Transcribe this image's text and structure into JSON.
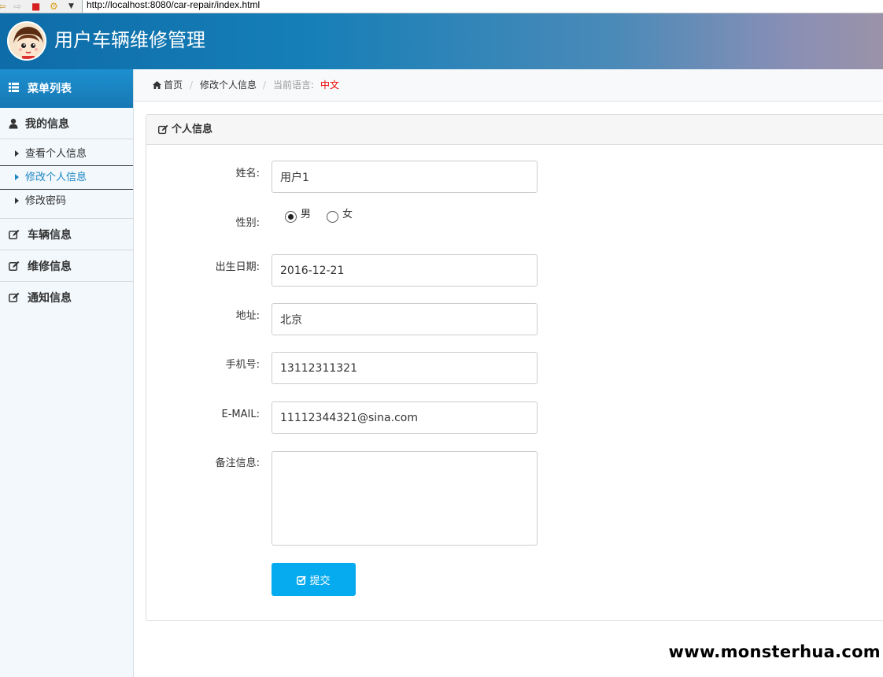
{
  "browser": {
    "url": "http://localhost:8080/car-repair/index.html"
  },
  "header": {
    "title": "用户车辆维修管理"
  },
  "sidebar": {
    "menu_title": "菜单列表",
    "groups": [
      {
        "label": "我的信息",
        "icon": "user-icon",
        "items": [
          {
            "label": "查看个人信息",
            "active": false
          },
          {
            "label": "修改个人信息",
            "active": true
          },
          {
            "label": "修改密码",
            "active": false
          }
        ]
      },
      {
        "label": "车辆信息",
        "icon": "edit-icon"
      },
      {
        "label": "维修信息",
        "icon": "edit-icon"
      },
      {
        "label": "通知信息",
        "icon": "edit-icon"
      }
    ]
  },
  "breadcrumb": {
    "home": "首页",
    "separator": "/",
    "current": "修改个人信息",
    "lang_label": "当前语言:",
    "lang_value": "中文"
  },
  "panel": {
    "title": "个人信息"
  },
  "form": {
    "name_label": "姓名:",
    "name_value": "用户1",
    "gender_label": "性别:",
    "gender_options": [
      "男",
      "女"
    ],
    "gender_selected": "男",
    "birth_label": "出生日期:",
    "birth_value": "2016-12-21",
    "address_label": "地址:",
    "address_value": "北京",
    "phone_label": "手机号:",
    "phone_value": "13112311321",
    "email_label": "E-MAIL:",
    "email_value": "11112344321@sina.com",
    "remark_label": "备注信息:",
    "remark_value": "",
    "submit_label": "提交"
  },
  "watermark": "www.monsterhua.com",
  "colors": {
    "accent": "#1b86c4",
    "submit": "#06aaee",
    "lang_value": "#ee0000"
  }
}
